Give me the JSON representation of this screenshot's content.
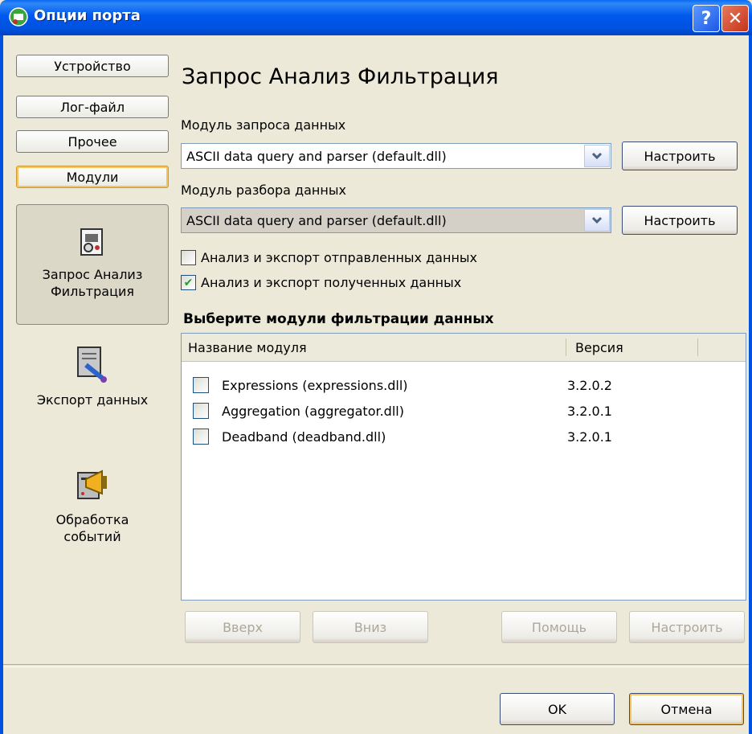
{
  "window": {
    "title": "Опции порта",
    "help_label": "?",
    "close_label": "✕"
  },
  "categories": [
    {
      "label": "Устройство"
    },
    {
      "label": "Лог-файл"
    },
    {
      "label": "Прочее"
    },
    {
      "label": "Модули"
    }
  ],
  "nav_panel": [
    {
      "label": "Запрос Анализ\nФильтрация",
      "icon": "query-analysis-icon"
    },
    {
      "label": "Экспорт данных",
      "icon": "export-icon"
    },
    {
      "label": "Обработка\nсобытий",
      "icon": "event-processing-icon"
    }
  ],
  "main": {
    "heading": "Запрос Анализ Фильтрация",
    "query_module_label": "Модуль запроса данных",
    "query_module_value": "ASCII data query and parser (default.dll)",
    "parse_module_label": "Модуль разбора данных",
    "parse_module_value": "ASCII data query and parser (default.dll)",
    "configure_label": "Настроить",
    "check_sent_label": "Анализ и экспорт отправленных данных",
    "check_sent_checked": false,
    "check_received_label": "Анализ и экспорт полученных данных",
    "check_received_checked": true,
    "filter_section_label": "Выберите модули фильтрации данных"
  },
  "filter_list": {
    "columns": [
      "Название модуля",
      "Версия"
    ],
    "rows": [
      {
        "name": "Expressions (expressions.dll)",
        "version": "3.2.0.2",
        "checked": false
      },
      {
        "name": "Aggregation (aggregator.dll)",
        "version": "3.2.0.1",
        "checked": false
      },
      {
        "name": "Deadband (deadband.dll)",
        "version": "3.2.0.1",
        "checked": false
      }
    ]
  },
  "list_buttons": {
    "up": "Вверх",
    "down": "Вниз",
    "help": "Помощь",
    "configure": "Настроить"
  },
  "dialog_buttons": {
    "ok": "OK",
    "cancel": "Отмена"
  },
  "colors": {
    "titlebar": "#0052df",
    "window_bg": "#ece9d8",
    "active_highlight": "#f6c45a"
  }
}
